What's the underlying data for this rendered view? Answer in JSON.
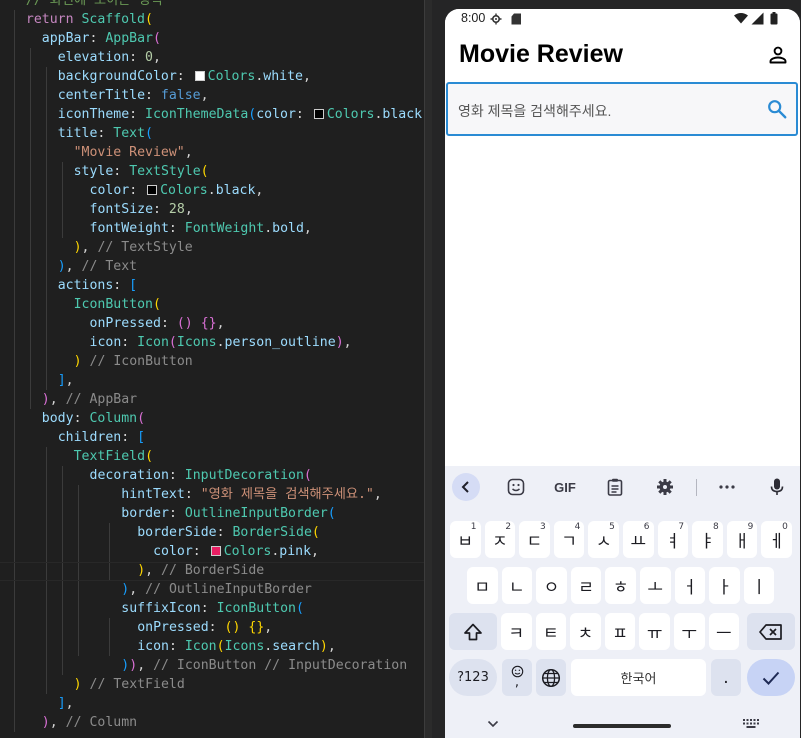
{
  "editor": {
    "lines": [
      [
        [
          "com",
          "// 화면에 보이는 영역"
        ]
      ],
      [
        [
          "ctl",
          "return"
        ],
        [
          "pun",
          " "
        ],
        [
          "cls",
          "Scaffold"
        ],
        [
          "p1",
          "("
        ]
      ],
      [
        [
          "prop",
          "appBar"
        ],
        [
          "pun",
          ": "
        ],
        [
          "cls",
          "AppBar"
        ],
        [
          "p2",
          "("
        ]
      ],
      [
        [
          "prop",
          "elevation"
        ],
        [
          "pun",
          ": "
        ],
        [
          "num",
          "0"
        ],
        [
          "pun",
          ","
        ]
      ],
      [
        [
          "prop",
          "backgroundColor"
        ],
        [
          "pun",
          ": "
        ],
        [
          "swatch",
          "#ffffff"
        ],
        [
          "cls",
          "Colors"
        ],
        [
          "pun",
          "."
        ],
        [
          "prop",
          "white"
        ],
        [
          "pun",
          ","
        ]
      ],
      [
        [
          "prop",
          "centerTitle"
        ],
        [
          "pun",
          ": "
        ],
        [
          "kw",
          "false"
        ],
        [
          "pun",
          ","
        ]
      ],
      [
        [
          "prop",
          "iconTheme"
        ],
        [
          "pun",
          ": "
        ],
        [
          "cls",
          "IconThemeData"
        ],
        [
          "p3",
          "("
        ],
        [
          "prop",
          "color"
        ],
        [
          "pun",
          ": "
        ],
        [
          "swatch",
          "#000000"
        ],
        [
          "cls",
          "Colors"
        ],
        [
          "pun",
          "."
        ],
        [
          "prop",
          "black"
        ],
        [
          "p3",
          ")"
        ],
        [
          "pun",
          ","
        ]
      ],
      [
        [
          "prop",
          "title"
        ],
        [
          "pun",
          ": "
        ],
        [
          "cls",
          "Text"
        ],
        [
          "p3",
          "("
        ]
      ],
      [
        [
          "str",
          "\"Movie Review\""
        ],
        [
          "pun",
          ","
        ]
      ],
      [
        [
          "prop",
          "style"
        ],
        [
          "pun",
          ": "
        ],
        [
          "cls",
          "TextStyle"
        ],
        [
          "p1",
          "("
        ]
      ],
      [
        [
          "prop",
          "color"
        ],
        [
          "pun",
          ": "
        ],
        [
          "swatch",
          "#000000"
        ],
        [
          "cls",
          "Colors"
        ],
        [
          "pun",
          "."
        ],
        [
          "prop",
          "black"
        ],
        [
          "pun",
          ","
        ]
      ],
      [
        [
          "prop",
          "fontSize"
        ],
        [
          "pun",
          ": "
        ],
        [
          "num",
          "28"
        ],
        [
          "pun",
          ","
        ]
      ],
      [
        [
          "prop",
          "fontWeight"
        ],
        [
          "pun",
          ": "
        ],
        [
          "cls",
          "FontWeight"
        ],
        [
          "pun",
          "."
        ],
        [
          "prop",
          "bold"
        ],
        [
          "pun",
          ","
        ]
      ],
      [
        [
          "p1",
          ")"
        ],
        [
          "pun",
          ", "
        ],
        [
          "hint",
          "// TextStyle"
        ]
      ],
      [
        [
          "p3",
          ")"
        ],
        [
          "pun",
          ", "
        ],
        [
          "hint",
          "// Text"
        ]
      ],
      [
        [
          "prop",
          "actions"
        ],
        [
          "pun",
          ": "
        ],
        [
          "p3",
          "["
        ]
      ],
      [
        [
          "cls",
          "IconButton"
        ],
        [
          "p1",
          "("
        ]
      ],
      [
        [
          "prop",
          "onPressed"
        ],
        [
          "pun",
          ": "
        ],
        [
          "p2",
          "()"
        ],
        [
          "pun",
          " "
        ],
        [
          "p2",
          "{}"
        ],
        [
          "pun",
          ","
        ]
      ],
      [
        [
          "prop",
          "icon"
        ],
        [
          "pun",
          ": "
        ],
        [
          "cls",
          "Icon"
        ],
        [
          "p2",
          "("
        ],
        [
          "cls",
          "Icons"
        ],
        [
          "pun",
          "."
        ],
        [
          "prop",
          "person_outline"
        ],
        [
          "p2",
          ")"
        ],
        [
          "pun",
          ","
        ]
      ],
      [
        [
          "p1",
          ")"
        ],
        [
          "pun",
          " "
        ],
        [
          "hint",
          "// IconButton"
        ]
      ],
      [
        [
          "p3",
          "]"
        ],
        [
          "pun",
          ","
        ]
      ],
      [
        [
          "p2",
          ")"
        ],
        [
          "pun",
          ", "
        ],
        [
          "hint",
          "// AppBar"
        ]
      ],
      [
        [
          "prop",
          "body"
        ],
        [
          "pun",
          ": "
        ],
        [
          "cls",
          "Column"
        ],
        [
          "p2",
          "("
        ]
      ],
      [
        [
          "prop",
          "children"
        ],
        [
          "pun",
          ": "
        ],
        [
          "p3",
          "["
        ]
      ],
      [
        [
          "cls",
          "TextField"
        ],
        [
          "p1",
          "("
        ]
      ],
      [
        [
          "prop",
          "decoration"
        ],
        [
          "pun",
          ": "
        ],
        [
          "cls",
          "InputDecoration"
        ],
        [
          "p2",
          "("
        ]
      ],
      [
        [
          "prop",
          "hintText"
        ],
        [
          "pun",
          ": "
        ],
        [
          "str",
          "\"영화 제목을 검색해주세요.\""
        ],
        [
          "pun",
          ","
        ]
      ],
      [
        [
          "prop",
          "border"
        ],
        [
          "pun",
          ": "
        ],
        [
          "cls",
          "OutlineInputBorder"
        ],
        [
          "p3",
          "("
        ]
      ],
      [
        [
          "prop",
          "borderSide"
        ],
        [
          "pun",
          ": "
        ],
        [
          "cls",
          "BorderSide"
        ],
        [
          "p1",
          "("
        ]
      ],
      [
        [
          "prop",
          "color"
        ],
        [
          "pun",
          ": "
        ],
        [
          "swatch",
          "#e91e63"
        ],
        [
          "cls",
          "Colors"
        ],
        [
          "pun",
          "."
        ],
        [
          "prop",
          "pink"
        ],
        [
          "pun",
          ","
        ]
      ],
      [
        [
          "p1",
          ")"
        ],
        [
          "pun",
          ", "
        ],
        [
          "hint",
          "// BorderSide"
        ]
      ],
      [
        [
          "p3",
          ")"
        ],
        [
          "pun",
          ", "
        ],
        [
          "hint",
          "// OutlineInputBorder"
        ]
      ],
      [
        [
          "prop",
          "suffixIcon"
        ],
        [
          "pun",
          ": "
        ],
        [
          "cls",
          "IconButton"
        ],
        [
          "p3",
          "("
        ]
      ],
      [
        [
          "prop",
          "onPressed"
        ],
        [
          "pun",
          ": "
        ],
        [
          "p1",
          "()"
        ],
        [
          "pun",
          " "
        ],
        [
          "p1",
          "{}"
        ],
        [
          "pun",
          ","
        ]
      ],
      [
        [
          "prop",
          "icon"
        ],
        [
          "pun",
          ": "
        ],
        [
          "cls",
          "Icon"
        ],
        [
          "p1",
          "("
        ],
        [
          "cls",
          "Icons"
        ],
        [
          "pun",
          "."
        ],
        [
          "prop",
          "search"
        ],
        [
          "p1",
          ")"
        ],
        [
          "pun",
          ","
        ]
      ],
      [
        [
          "p3",
          ")"
        ],
        [
          "p2",
          ")"
        ],
        [
          "pun",
          ", "
        ],
        [
          "hint",
          "// IconButton // InputDecoration"
        ]
      ],
      [
        [
          "p1",
          ")"
        ],
        [
          "pun",
          " "
        ],
        [
          "hint",
          "// TextField"
        ]
      ],
      [
        [
          "p3",
          "]"
        ],
        [
          "pun",
          ","
        ]
      ],
      [
        [
          "p2",
          ")"
        ],
        [
          "pun",
          ", "
        ],
        [
          "hint",
          "// Column"
        ]
      ]
    ]
  },
  "status_bar": {
    "time": "8:00"
  },
  "app": {
    "title": "Movie Review",
    "person_icon": "person-outline-icon",
    "search_hint": "영화 제목을 검색해주세요.",
    "search_icon": "search-icon",
    "border_color": "#2a8bd4"
  },
  "keyboard": {
    "toolbar": [
      "back-icon",
      "sticker-icon",
      "GIF",
      "clipboard-icon",
      "settings-icon",
      "more-icon",
      "mic-icon"
    ],
    "row1": [
      {
        "c": "ㅂ",
        "h": "1"
      },
      {
        "c": "ㅈ",
        "h": "2"
      },
      {
        "c": "ㄷ",
        "h": "3"
      },
      {
        "c": "ㄱ",
        "h": "4"
      },
      {
        "c": "ㅅ",
        "h": "5"
      },
      {
        "c": "ㅛ",
        "h": "6"
      },
      {
        "c": "ㅕ",
        "h": "7"
      },
      {
        "c": "ㅑ",
        "h": "8"
      },
      {
        "c": "ㅐ",
        "h": "9"
      },
      {
        "c": "ㅔ",
        "h": "0"
      }
    ],
    "row2": [
      "ㅁ",
      "ㄴ",
      "ㅇ",
      "ㄹ",
      "ㅎ",
      "ㅗ",
      "ㅓ",
      "ㅏ",
      "ㅣ"
    ],
    "row3": [
      "ㅋ",
      "ㅌ",
      "ㅊ",
      "ㅍ",
      "ㅠ",
      "ㅜ",
      "ㅡ"
    ],
    "symbols_label": "?123",
    "emoji_comma": ",",
    "space_label": "한국어",
    "period": "."
  }
}
